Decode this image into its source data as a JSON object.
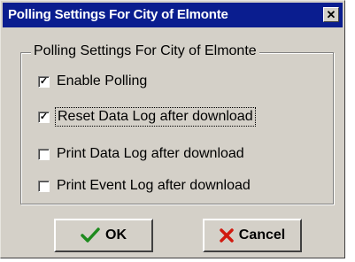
{
  "window": {
    "title": "Polling Settings For City of Elmonte",
    "close_glyph": "✕"
  },
  "group": {
    "legend": "Polling Settings For City of Elmonte"
  },
  "options": [
    {
      "label": "Enable Polling",
      "checked": true
    },
    {
      "label": "Reset Data Log after download",
      "checked": true
    },
    {
      "label": "Print Data Log after download",
      "checked": false
    },
    {
      "label": "Print Event Log after download",
      "checked": false
    }
  ],
  "buttons": {
    "ok_label": "OK",
    "cancel_label": "Cancel",
    "ok_icon": "checkmark-icon",
    "cancel_icon": "x-mark-icon"
  },
  "colors": {
    "titlebar": "#0a1d8f",
    "ok_icon": "#1e8a1e",
    "cancel_icon": "#d11a0f",
    "face": "#d4d0c8"
  }
}
